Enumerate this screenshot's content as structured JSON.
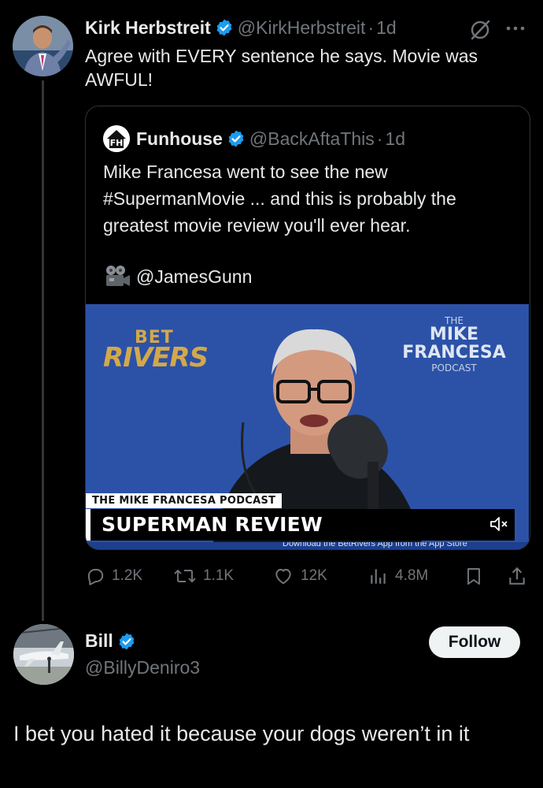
{
  "tweet": {
    "author_name": "Kirk Herbstreit",
    "handle": "@KirkHerbstreit",
    "separator": "·",
    "time": "1d",
    "text": "Agree with EVERY sentence he says. Movie was AWFUL!",
    "menu_icon": "more-icon",
    "grok_icon": "grok-icon"
  },
  "quote": {
    "author_name": "Funhouse",
    "handle": "@BackAftaThis",
    "separator": "·",
    "time": "1d",
    "text": "Mike Francesa went to see the new #SupermanMovie ... and this is probably the greatest movie review you'll ever hear.",
    "mention_icon": "movie-camera-icon",
    "mention": "@JamesGunn",
    "video": {
      "sponsor_top": "BET",
      "sponsor_bottom": "RIVERS",
      "podcast_line1": "THE",
      "podcast_line2": "MIKE",
      "podcast_line3": "FRANCESA",
      "podcast_line4": "PODCAST",
      "lower_third_small": "THE MIKE FRANCESA PODCAST",
      "lower_third_title": "SUPERMAN REVIEW",
      "ticker_text": "Download the BetRivers App from the App Store",
      "background_color": "#2c52a8"
    }
  },
  "actions": {
    "replies": "1.2K",
    "reposts": "1.1K",
    "likes": "12K",
    "views": "4.8M"
  },
  "reply": {
    "author_name": "Bill",
    "handle": "@BillyDeniro3",
    "follow_label": "Follow",
    "text": "I bet you hated it because your dogs weren’t in it"
  },
  "colors": {
    "background": "#000000",
    "text": "#e7e9ea",
    "muted": "#71767b",
    "verified": "#1d9bf0",
    "border": "#2f3336"
  }
}
